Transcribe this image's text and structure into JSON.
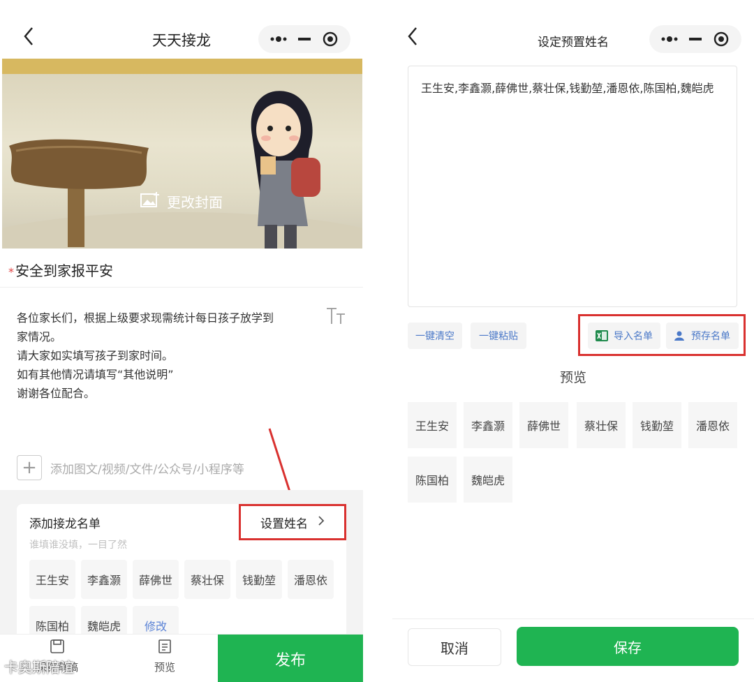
{
  "left": {
    "nav_title": "天天接龙",
    "cover_caption": "更改封面",
    "required_mark": "*",
    "title": "安全到家报平安",
    "description": [
      "各位家长们，根据上级要求现需统计每日孩子放学到",
      "家情况。",
      "请大家如实填写孩子到家时间。",
      "如有其他情况请填写“其他说明”",
      "谢谢各位配合。"
    ],
    "font_size_icon_label": "TT",
    "add_media_label": "添加图文/视频/文件/公众号/小程序等",
    "list": {
      "heading": "添加接龙名单",
      "subtitle": "谁填谁没填，一目了然",
      "set_names_label": "设置姓名",
      "names": [
        "王生安",
        "李鑫灏",
        "薛佛世",
        "蔡壮保",
        "钱勤堃",
        "潘恩依",
        "陈国柏",
        "魏皑虎"
      ],
      "edit_label": "修改"
    },
    "bottom": {
      "save_draft_label": "保存草稿",
      "preview_label": "预览",
      "publish_label": "发布"
    },
    "watermark": "卡奥斯陪谊"
  },
  "right": {
    "nav_title": "设定预置姓名",
    "textarea_text": "王生安,李鑫灏,薛佛世,蔡壮保,钱勤堃,潘恩依,陈国柏,魏皑虎",
    "clear_label": "一键清空",
    "paste_label": "一键粘贴",
    "import_label": "导入名单",
    "presaved_label": "预存名单",
    "preview_title": "预览",
    "names": [
      "王生安",
      "李鑫灏",
      "薛佛世",
      "蔡壮保",
      "钱勤堃",
      "潘恩依",
      "陈国柏",
      "魏皑虎"
    ],
    "cancel_label": "取消",
    "save_label": "保存"
  },
  "colors": {
    "accent_green": "#1fb452",
    "highlight_red": "#d9312f",
    "link_blue": "#4b79c8"
  }
}
